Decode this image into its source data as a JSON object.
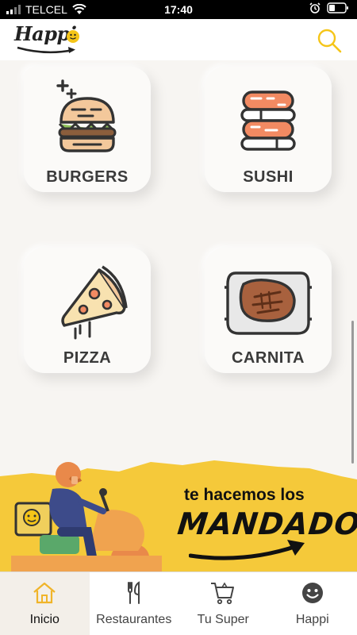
{
  "status_bar": {
    "carrier": "TELCEL",
    "time": "17:40",
    "icons": [
      "signal-icon",
      "wifi-icon",
      "alarm-icon",
      "battery-icon"
    ]
  },
  "header": {
    "brand": "Happi",
    "icons": [
      "smile-icon",
      "search-icon"
    ],
    "accent_color": "#f5c518"
  },
  "categories": [
    {
      "label": "BURGERS",
      "icon": "burger-icon"
    },
    {
      "label": "SUSHI",
      "icon": "sushi-icon"
    },
    {
      "label": "PIZZA",
      "icon": "pizza-icon"
    },
    {
      "label": "CARNITA",
      "icon": "grill-icon"
    }
  ],
  "banner": {
    "line1": "te hacemos los",
    "line2": "MANDADOS",
    "icon": "delivery-scooter-icon",
    "background_color": "#f5c93a"
  },
  "tabs": [
    {
      "label": "Inicio",
      "icon": "home-icon",
      "active": true
    },
    {
      "label": "Restaurantes",
      "icon": "cutlery-icon",
      "active": false
    },
    {
      "label": "Tu Super",
      "icon": "cart-icon",
      "active": false
    },
    {
      "label": "Happi",
      "icon": "smile-icon",
      "active": false
    }
  ]
}
